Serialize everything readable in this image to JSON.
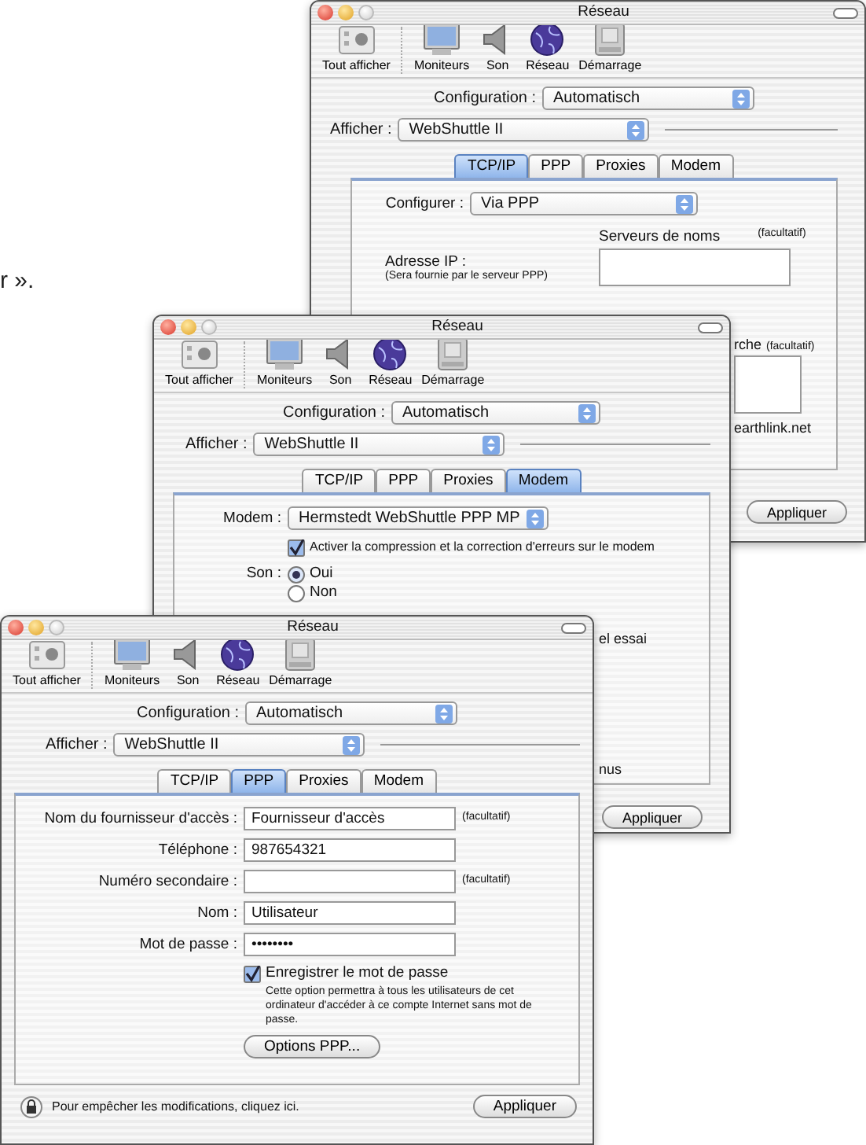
{
  "page_text": "r ».",
  "windows": [
    {
      "title": "Réseau",
      "toolbar": [
        {
          "kind": "all",
          "label": "Tout afficher"
        },
        {
          "kind": "display",
          "label": "Moniteurs"
        },
        {
          "kind": "sound",
          "label": "Son"
        },
        {
          "kind": "network",
          "label": "Réseau"
        },
        {
          "kind": "startup",
          "label": "Démarrage"
        }
      ],
      "configuration": {
        "label": "Configuration :",
        "value": "Automatisch"
      },
      "afficher": {
        "label": "Afficher :",
        "value": "WebShuttle II"
      },
      "tabs": [
        {
          "label": "TCP/IP",
          "selected": true
        },
        {
          "label": "PPP",
          "selected": false
        },
        {
          "label": "Proxies",
          "selected": false
        },
        {
          "label": "Modem",
          "selected": false
        }
      ],
      "panel": [
        {
          "kind": "select",
          "label": "Configurer :",
          "value": "Via PPP"
        },
        {
          "kind": "ip_dns",
          "ip_label": "Adresse IP :",
          "ip_note": "(Sera fournie par le serveur PPP)",
          "dns_label": "Serveurs de noms",
          "dns_hint": "(facultatif)"
        }
      ],
      "fragments": [
        {
          "kind": "label_hint",
          "text": "rche",
          "hint": "(facultatif)"
        },
        {
          "kind": "textbox"
        },
        {
          "kind": "text",
          "text": "earthlink.net"
        },
        {
          "kind": "button",
          "label": "Appliquer"
        }
      ]
    },
    {
      "title": "Réseau",
      "toolbar": [
        {
          "kind": "all",
          "label": "Tout afficher"
        },
        {
          "kind": "display",
          "label": "Moniteurs"
        },
        {
          "kind": "sound",
          "label": "Son"
        },
        {
          "kind": "network",
          "label": "Réseau"
        },
        {
          "kind": "startup",
          "label": "Démarrage"
        }
      ],
      "configuration": {
        "label": "Configuration :",
        "value": "Automatisch"
      },
      "afficher": {
        "label": "Afficher :",
        "value": "WebShuttle II"
      },
      "tabs": [
        {
          "label": "TCP/IP",
          "selected": false
        },
        {
          "label": "PPP",
          "selected": false
        },
        {
          "label": "Proxies",
          "selected": false
        },
        {
          "label": "Modem",
          "selected": true
        }
      ],
      "panel": [
        {
          "kind": "select",
          "label": "Modem :",
          "value": "Hermstedt WebShuttle PPP MP"
        },
        {
          "kind": "checkbox",
          "label": "Activer la compression et la correction d'erreurs sur le modem",
          "checked": true
        },
        {
          "kind": "radios",
          "label": "Son :",
          "options": [
            {
              "label": "Oui",
              "selected": true
            },
            {
              "label": "Non",
              "selected": false
            }
          ]
        }
      ],
      "fragments": [
        {
          "kind": "text",
          "text": "el essai"
        },
        {
          "kind": "text",
          "text": "nus"
        },
        {
          "kind": "button",
          "label": "Appliquer"
        }
      ]
    },
    {
      "title": "Réseau",
      "toolbar": [
        {
          "kind": "all",
          "label": "Tout afficher"
        },
        {
          "kind": "display",
          "label": "Moniteurs"
        },
        {
          "kind": "sound",
          "label": "Son"
        },
        {
          "kind": "network",
          "label": "Réseau"
        },
        {
          "kind": "startup",
          "label": "Démarrage"
        }
      ],
      "configuration": {
        "label": "Configuration :",
        "value": "Automatisch"
      },
      "afficher": {
        "label": "Afficher :",
        "value": "WebShuttle II"
      },
      "tabs": [
        {
          "label": "TCP/IP",
          "selected": false
        },
        {
          "label": "PPP",
          "selected": true
        },
        {
          "label": "Proxies",
          "selected": false
        },
        {
          "label": "Modem",
          "selected": false
        }
      ],
      "panel": [
        {
          "kind": "field",
          "label": "Nom du fournisseur d'accès :",
          "value": "Fournisseur d'accès",
          "hint": "(facultatif)"
        },
        {
          "kind": "field",
          "label": "Téléphone :",
          "value": "987654321"
        },
        {
          "kind": "field",
          "label": "Numéro secondaire :",
          "hint": "(facultatif)"
        },
        {
          "kind": "field",
          "label": "Nom :",
          "value": "Utilisateur"
        },
        {
          "kind": "password",
          "label": "Mot de passe :",
          "value": "••••••••"
        },
        {
          "kind": "checkbox",
          "label": "Enregistrer le mot de passe",
          "checked": true,
          "description": "Cette option permettra à tous les utilisateurs de cet ordinateur d'accéder à ce compte Internet sans mot de passe."
        },
        {
          "kind": "button",
          "label": "Options PPP..."
        }
      ],
      "footer": {
        "lock_text": "Pour empêcher les modifications, cliquez ici.",
        "apply": "Appliquer"
      }
    }
  ]
}
